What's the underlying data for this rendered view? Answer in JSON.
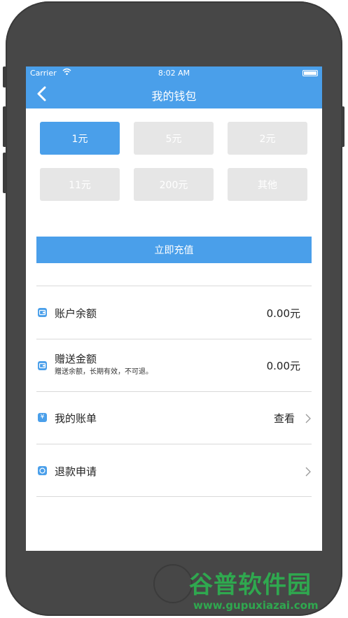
{
  "status_bar": {
    "carrier": "Carrier",
    "time": "8:02 AM",
    "wifi_icon": "wifi-icon",
    "battery_icon": "battery-icon"
  },
  "nav": {
    "title": "我的钱包",
    "back_icon": "chevron-left-icon"
  },
  "amount_options": [
    {
      "label": "1元",
      "selected": true
    },
    {
      "label": "5元",
      "selected": false
    },
    {
      "label": "2元",
      "selected": false
    },
    {
      "label": "11元",
      "selected": false
    },
    {
      "label": "200元",
      "selected": false
    },
    {
      "label": "其他",
      "selected": false
    }
  ],
  "recharge_button": "立即充值",
  "rows": [
    {
      "icon": "wallet-icon",
      "label": "账户余额",
      "value": "0.00元"
    },
    {
      "icon": "wallet-icon",
      "label": "赠送金额",
      "sublabel": "赠送余额，长期有效，不可退。",
      "value": "0.00元"
    },
    {
      "icon": "yen-icon",
      "label": "我的账单",
      "value": "查看",
      "chevron": true
    },
    {
      "icon": "refund-icon",
      "label": "退款申请",
      "chevron": true
    }
  ],
  "watermark": {
    "brand": "谷普软件园",
    "url": "www.gupuxiazai.com"
  },
  "colors": {
    "accent": "#4a9fea",
    "disabled_option": "#e6e6e6",
    "phone_body": "#474747",
    "watermark": "#2fa84f"
  }
}
